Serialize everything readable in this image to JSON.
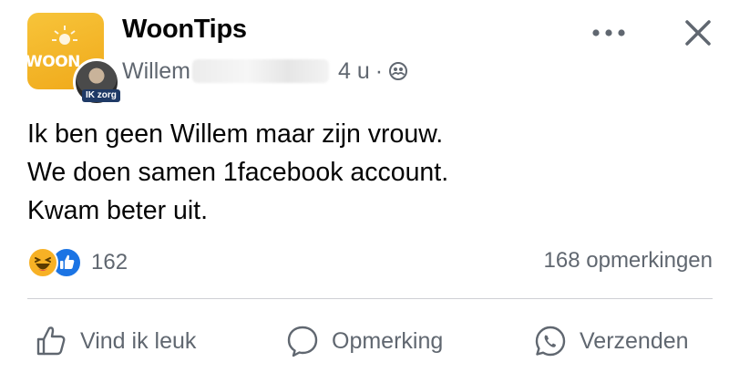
{
  "header": {
    "page_name": "WoonTips",
    "page_avatar_text": "WOON",
    "user_avatar_tag": "IK zorg",
    "author": "Willem",
    "time": "4 u",
    "separator": "·",
    "privacy_icon": "friends-icon"
  },
  "post": {
    "lines": [
      "Ik ben geen Willem maar zijn vrouw.",
      "We doen samen 1facebook account.",
      "Kwam beter uit."
    ]
  },
  "reactions": {
    "icons": [
      "haha-icon",
      "like-icon"
    ],
    "count": "162",
    "comments": "168 opmerkingen"
  },
  "actions": {
    "like": "Vind ik leuk",
    "comment": "Opmerking",
    "share": "Verzenden"
  },
  "colors": {
    "text": "#050505",
    "secondary": "#606770",
    "like_blue": "#1b74e4",
    "haha_yellow": "#f7b125",
    "brand_yellow": "#f0a91a"
  }
}
